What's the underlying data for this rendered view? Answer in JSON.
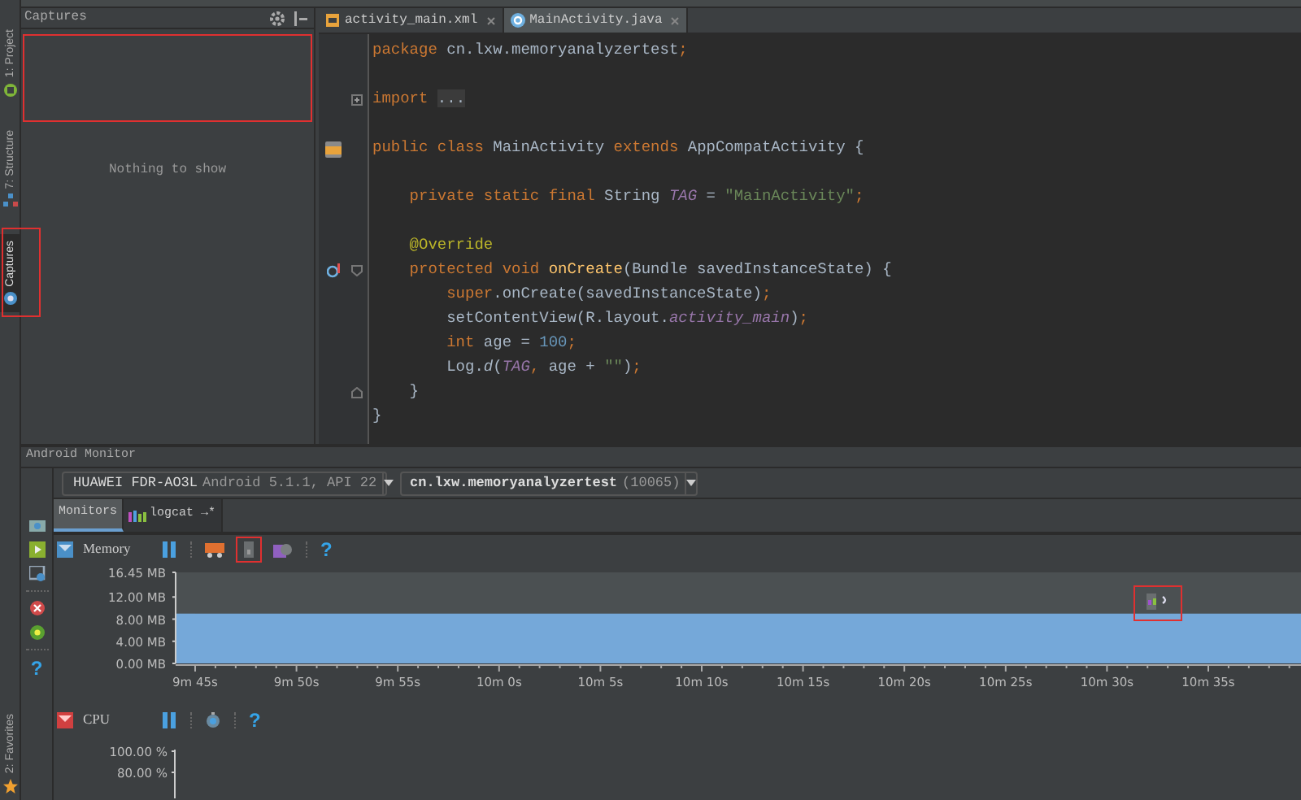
{
  "left_toolbar": {
    "tabs": [
      {
        "label": "1: Project",
        "selected": false,
        "kind": "project",
        "highlighted": false
      },
      {
        "label": "7: Structure",
        "selected": false,
        "kind": "structure",
        "highlighted": false
      },
      {
        "label": "Captures",
        "selected": true,
        "kind": "captures",
        "highlighted": true
      }
    ],
    "bottom_tabs": [
      {
        "label": "2: Favorites",
        "selected": false,
        "kind": "favorites",
        "highlighted": false
      }
    ]
  },
  "captures_panel": {
    "title": "Captures",
    "highlighted": true,
    "empty_text": "Nothing to show"
  },
  "editor": {
    "tabs": [
      {
        "label": "activity_main.xml",
        "selected": false,
        "kind": "xml"
      },
      {
        "label": "MainActivity.java",
        "selected": true,
        "kind": "java"
      }
    ],
    "lines": [
      {
        "kind": "code",
        "tokens": [
          {
            "t": "package",
            "kind": "kw"
          },
          {
            "t": " cn.lxw.memoryanalyzertest",
            "kind": "plain"
          },
          {
            "t": ";",
            "kind": "kw"
          }
        ]
      },
      {
        "kind": "blank"
      },
      {
        "kind": "code",
        "fold": {
          "kind": "plus"
        },
        "tokens": [
          {
            "t": "import ",
            "kind": "kw"
          },
          {
            "t": "...",
            "kind": "folded"
          }
        ]
      },
      {
        "kind": "blank"
      },
      {
        "kind": "code",
        "gutter": {
          "kind": "class"
        },
        "tokens": [
          {
            "t": "public class",
            "kind": "kw"
          },
          {
            "t": " MainActivity ",
            "kind": "plain"
          },
          {
            "t": "extends",
            "kind": "kw"
          },
          {
            "t": " AppCompatActivity {",
            "kind": "plain"
          }
        ]
      },
      {
        "kind": "blank"
      },
      {
        "kind": "code",
        "tokens": [
          {
            "t": "    private static final",
            "kind": "kw"
          },
          {
            "t": " String ",
            "kind": "plain"
          },
          {
            "t": "TAG",
            "kind": "field"
          },
          {
            "t": " = ",
            "kind": "plain"
          },
          {
            "t": "\"MainActivity\"",
            "kind": "str"
          },
          {
            "t": ";",
            "kind": "kw"
          }
        ]
      },
      {
        "kind": "blank"
      },
      {
        "kind": "code",
        "tokens": [
          {
            "t": "    @Override",
            "kind": "annot"
          }
        ]
      },
      {
        "kind": "code",
        "gutter": {
          "kind": "override"
        },
        "fold": {
          "kind": "start"
        },
        "tokens": [
          {
            "t": "    protected void ",
            "kind": "kw"
          },
          {
            "t": "onCreate",
            "kind": "method"
          },
          {
            "t": "(Bundle savedInstanceState) {",
            "kind": "plain"
          }
        ]
      },
      {
        "kind": "code",
        "tokens": [
          {
            "t": "        super",
            "kind": "kw"
          },
          {
            "t": ".onCreate(savedInstanceState)",
            "kind": "plain"
          },
          {
            "t": ";",
            "kind": "kw"
          }
        ]
      },
      {
        "kind": "code",
        "tokens": [
          {
            "t": "        setContentView(R.layout.",
            "kind": "plain"
          },
          {
            "t": "activity_main",
            "kind": "field"
          },
          {
            "t": ")",
            "kind": "plain"
          },
          {
            "t": ";",
            "kind": "kw"
          }
        ]
      },
      {
        "kind": "code",
        "tokens": [
          {
            "t": "        int",
            "kind": "kw"
          },
          {
            "t": " age = ",
            "kind": "plain"
          },
          {
            "t": "100",
            "kind": "num"
          },
          {
            "t": ";",
            "kind": "kw"
          }
        ]
      },
      {
        "kind": "code",
        "tokens": [
          {
            "t": "        Log.",
            "kind": "plain"
          },
          {
            "t": "d",
            "kind": "static"
          },
          {
            "t": "(",
            "kind": "plain"
          },
          {
            "t": "TAG",
            "kind": "field"
          },
          {
            "t": ", ",
            "kind": "kw"
          },
          {
            "t": "age + ",
            "kind": "plain"
          },
          {
            "t": "\"\"",
            "kind": "str"
          },
          {
            "t": ")",
            "kind": "plain"
          },
          {
            "t": ";",
            "kind": "kw"
          }
        ]
      },
      {
        "kind": "code",
        "fold": {
          "kind": "end"
        },
        "tokens": [
          {
            "t": "    }",
            "kind": "plain"
          }
        ]
      },
      {
        "kind": "code",
        "tokens": [
          {
            "t": "}",
            "kind": "plain"
          }
        ]
      }
    ]
  },
  "monitor": {
    "title": "Android Monitor",
    "side_tools": [
      {
        "kind": "screenshot"
      },
      {
        "kind": "record"
      },
      {
        "kind": "layout"
      },
      {
        "kind": "terminate"
      },
      {
        "kind": "sysinfo"
      },
      {
        "kind": "help",
        "label": "?"
      }
    ],
    "device": {
      "name": "HUAWEI FDR-AO3L",
      "detail": "Android 5.1.1, API 22"
    },
    "process": {
      "name": "cn.lxw.memoryanalyzertest",
      "pid": "(10065)"
    },
    "tabs": [
      {
        "label": "Monitors",
        "selected": true,
        "kind": "monitors"
      },
      {
        "label": "logcat →*",
        "selected": false,
        "kind": "logcat"
      }
    ],
    "memory": {
      "title": "Memory",
      "tools": [
        {
          "kind": "pause",
          "highlighted": false
        },
        {
          "kind": "gc",
          "highlighted": false
        },
        {
          "kind": "dump_heap",
          "highlighted": true
        },
        {
          "kind": "alloc",
          "highlighted": false
        },
        {
          "kind": "help",
          "label": "?",
          "highlighted": false
        }
      ],
      "marker": {
        "highlighted": true
      },
      "chart_data": {
        "type": "area",
        "categories": [
          "9m 45s",
          "9m 50s",
          "9m 55s",
          "10m 0s",
          "10m 5s",
          "10m 10s",
          "10m 15s",
          "10m 20s",
          "10m 25s",
          "10m 30s",
          "10m 35s",
          null
        ],
        "series": [
          {
            "color": "#75a8d9",
            "values": [
              9,
              9,
              9,
              9,
              9,
              9,
              9,
              9,
              9,
              9,
              9,
              9
            ]
          }
        ],
        "ylim": [
          0,
          16.45
        ],
        "yticks": [
          {
            "value": 16.45,
            "label": "16.45 MB"
          },
          {
            "value": 12,
            "label": "12.00 MB"
          },
          {
            "value": 8,
            "label": "8.00 MB"
          },
          {
            "value": 4,
            "label": "4.00 MB"
          },
          {
            "value": 0,
            "label": "0.00 MB"
          }
        ]
      }
    },
    "cpu": {
      "title": "CPU",
      "tools": [
        {
          "kind": "pause"
        },
        {
          "kind": "cpu_record"
        },
        {
          "kind": "help",
          "label": "?"
        }
      ],
      "axis_labels": [
        "100.00 %",
        "80.00 %"
      ]
    }
  }
}
